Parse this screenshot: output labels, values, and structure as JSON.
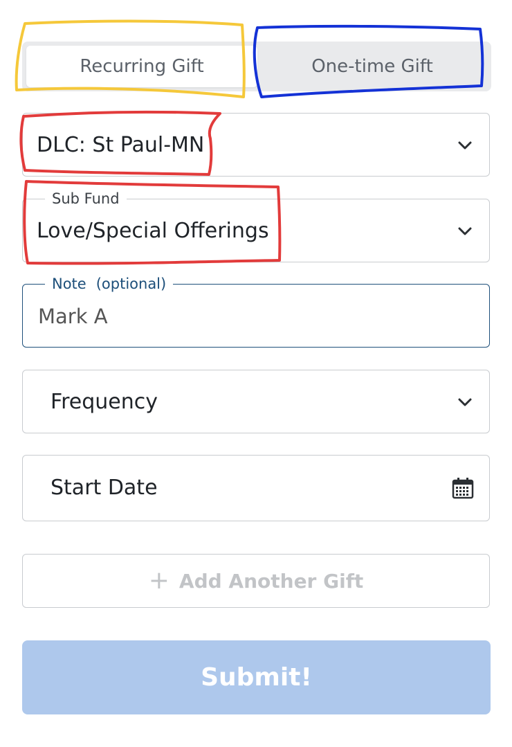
{
  "tabs": {
    "recurring": "Recurring Gift",
    "one_time": "One-time Gift"
  },
  "fund": {
    "value": "DLC: St Paul-MN"
  },
  "sub_fund": {
    "label": "Sub Fund",
    "value": "Love/Special Offerings"
  },
  "note": {
    "label": "Note",
    "optional": "(optional)",
    "value": "Mark A"
  },
  "frequency": {
    "placeholder": "Frequency"
  },
  "start_date": {
    "placeholder": "Start Date"
  },
  "add_gift": {
    "icon": "+",
    "label": "Add Another Gift"
  },
  "submit": {
    "label": "Submit!"
  },
  "colors": {
    "accent_focus": "#1d4f7a",
    "submit_disabled": "#aec8ec",
    "annotation_yellow": "#f5c83a",
    "annotation_blue": "#1432d6",
    "annotation_red": "#e23b3b"
  }
}
